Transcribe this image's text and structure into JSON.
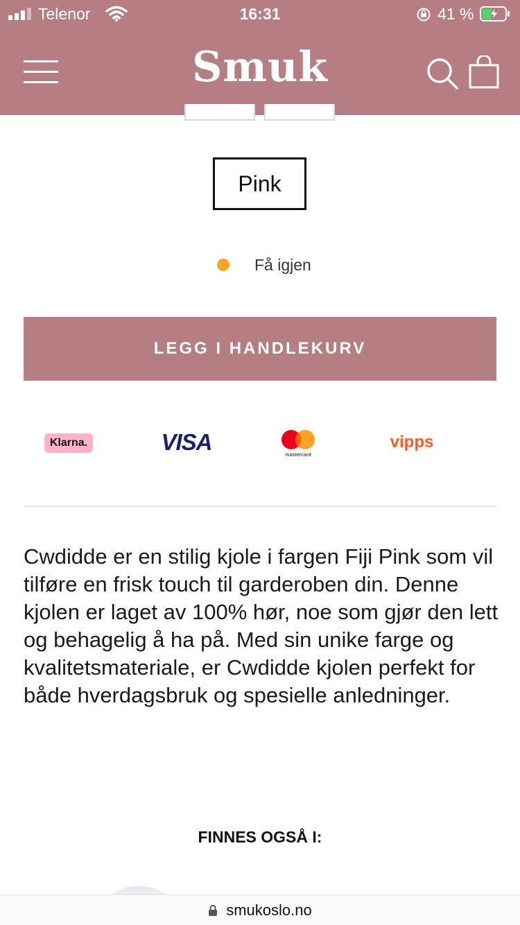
{
  "status_bar": {
    "carrier": "Telenor",
    "time": "16:31",
    "battery_percent": "41 %"
  },
  "header": {
    "logo": "Smuk",
    "menu_icon": "hamburger-menu-icon",
    "search_icon": "search-icon",
    "cart_icon": "shopping-bag-icon"
  },
  "product": {
    "selected_color": "Pink",
    "stock_status": "Få igjen",
    "stock_color": "#f5a623",
    "add_to_cart_label": "LEGG I HANDLEKURV",
    "description": "Cwdidde er en stilig kjole i fargen Fiji Pink som vil tilføre en frisk touch til garderoben din. Denne kjolen er laget av 100% hør, noe som gjør den lett og behagelig å ha på. Med sin unike farge og kvalitetsmateriale, er Cwdidde kjolen perfekt for både hverdagsbruk og spesielle anledninger.",
    "also_available_heading": "FINNES OGSÅ I:"
  },
  "payment_methods": {
    "klarna": "Klarna.",
    "visa": "VISA",
    "mastercard": "mastercard",
    "vipps": "vipps"
  },
  "browser": {
    "url": "smukoslo.no"
  },
  "colors": {
    "brand": "#b47e83",
    "stock_dot": "#f5a623",
    "vipps": "#ff5b24",
    "visa": "#1a1f71",
    "klarna_bg": "#ffb3c7"
  }
}
